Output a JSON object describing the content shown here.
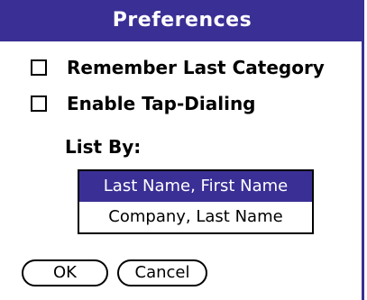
{
  "dialog": {
    "title": "Preferences"
  },
  "options": [
    {
      "label": "Remember Last Category",
      "checked": false
    },
    {
      "label": "Enable Tap-Dialing",
      "checked": false
    }
  ],
  "list_by": {
    "label": "List By:",
    "items": [
      {
        "label": "Last Name, First Name",
        "selected": true
      },
      {
        "label": "Company, Last Name",
        "selected": false
      }
    ]
  },
  "buttons": {
    "ok": "OK",
    "cancel": "Cancel"
  },
  "colors": {
    "accent": "#3a2f95",
    "background": "#ffffff",
    "text": "#000000"
  }
}
